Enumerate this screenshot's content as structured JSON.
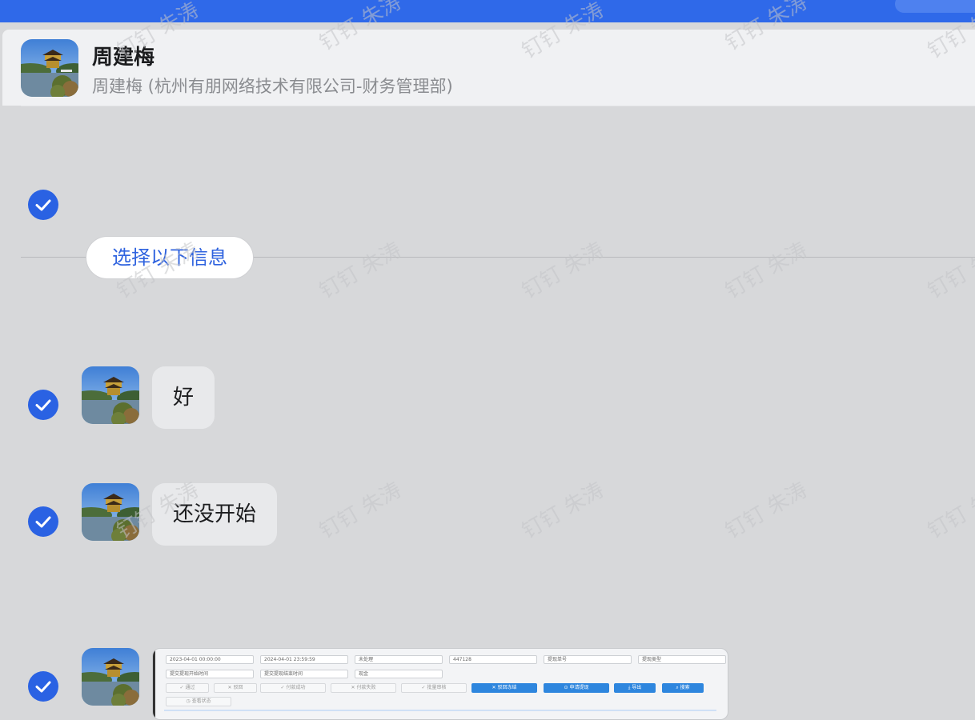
{
  "contact": {
    "name": "周建梅",
    "subtitle": "周建梅 (杭州有朋网络技术有限公司-财务管理部)"
  },
  "divider": {
    "label": "选择以下信息"
  },
  "messages": [
    {
      "text": "好"
    },
    {
      "text": "还没开始"
    }
  ],
  "watermark": {
    "text": "钉钉 朱涛"
  },
  "screenshot": {
    "fields": [
      "2023-04-01 00:00:00",
      "2024-04-01 23:59:59",
      "未处理",
      "447128",
      "提现单号",
      "提现类型",
      "提交提现开始时间",
      "提交提现结束时间",
      "现金"
    ],
    "buttons": [
      "✓ 通过",
      "✕ 驳回",
      "✓ 付款成功",
      "✕ 付款失败",
      "✓ 批量审核",
      "✕ 驳回冻结",
      "⊙ 申请提现",
      "⤓ 导出",
      "⌕ 搜索",
      "◷ 查看状态"
    ]
  },
  "colors": {
    "topbar": "#2f69e9",
    "accent": "#2a62e3",
    "background": "#d7d8da"
  }
}
